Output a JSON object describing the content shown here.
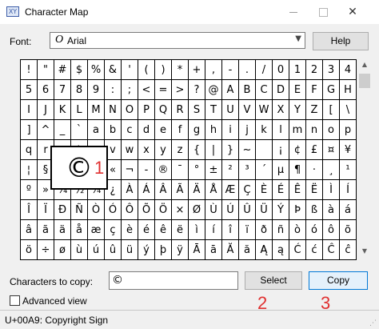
{
  "window": {
    "title": "Character Map",
    "icon": "character-map-app-icon",
    "icon_text": "XY",
    "minimize_icon": "minimize-icon",
    "maximize_icon": "maximize-icon",
    "close_icon": "close-icon",
    "close_glyph": "✕"
  },
  "font": {
    "label": "Font:",
    "selected": "Arial",
    "type_icon": "Ο",
    "dropdown_glyph": "▼"
  },
  "help_label": "Help",
  "grid": {
    "rows": [
      [
        "!",
        "\"",
        "#",
        "$",
        "%",
        "&",
        "'",
        "(",
        ")",
        "*",
        "+",
        ",",
        "-",
        ".",
        "/",
        "0",
        "1",
        "2",
        "3",
        "4"
      ],
      [
        "5",
        "6",
        "7",
        "8",
        "9",
        ":",
        ";",
        "<",
        "=",
        ">",
        "?",
        "@",
        "A",
        "B",
        "C",
        "D",
        "E",
        "F",
        "G",
        "H"
      ],
      [
        "I",
        "J",
        "K",
        "L",
        "M",
        "N",
        "O",
        "P",
        "Q",
        "R",
        "S",
        "T",
        "U",
        "V",
        "W",
        "X",
        "Y",
        "Z",
        "[",
        "\\"
      ],
      [
        "]",
        "^",
        "_",
        "`",
        "a",
        "b",
        "c",
        "d",
        "e",
        "f",
        "g",
        "h",
        "i",
        "j",
        "k",
        "l",
        "m",
        "n",
        "o",
        "p"
      ],
      [
        "q",
        "r",
        "s",
        "t",
        "u",
        "v",
        "w",
        "x",
        "y",
        "z",
        "{",
        "|",
        "}",
        "~",
        " ",
        "¡",
        "¢",
        "£",
        "¤",
        "¥"
      ],
      [
        "¦",
        "§",
        "¨",
        "©",
        "ª",
        "«",
        "¬",
        "-",
        "®",
        "¯",
        "°",
        "±",
        "²",
        "³",
        "´",
        "µ",
        "¶",
        "·",
        "¸",
        "¹"
      ],
      [
        "º",
        "»",
        "¼",
        "½",
        "¾",
        "¿",
        "À",
        "Á",
        "Â",
        "Ã",
        "Ä",
        "Å",
        "Æ",
        "Ç",
        "È",
        "É",
        "Ê",
        "Ë",
        "Ì",
        "Í"
      ],
      [
        "Î",
        "Ï",
        "Ð",
        "Ñ",
        "Ò",
        "Ó",
        "Ô",
        "Õ",
        "Ö",
        "×",
        "Ø",
        "Ù",
        "Ú",
        "Û",
        "Ü",
        "Ý",
        "Þ",
        "ß",
        "à",
        "á"
      ],
      [
        "â",
        "ã",
        "ä",
        "å",
        "æ",
        "ç",
        "è",
        "é",
        "ê",
        "ë",
        "ì",
        "í",
        "î",
        "ï",
        "ð",
        "ñ",
        "ò",
        "ó",
        "ô",
        "õ"
      ],
      [
        "ö",
        "÷",
        "ø",
        "ù",
        "ú",
        "û",
        "ü",
        "ý",
        "þ",
        "ÿ",
        "Ā",
        "ā",
        "Ă",
        "ă",
        "Ą",
        "ą",
        "Ć",
        "ć",
        "Ĉ",
        "ĉ"
      ]
    ],
    "selected_row": 5,
    "selected_col": 3
  },
  "magnified_char": "©",
  "scrollbar": {
    "up_glyph": "▲",
    "down_glyph": "▼"
  },
  "annotations": {
    "one": "1",
    "two": "2",
    "three": "3",
    "color": "#e03030"
  },
  "copy": {
    "label": "Characters to copy:",
    "value": "©",
    "select_label": "Select",
    "copy_label": "Copy"
  },
  "advanced_view_label": "Advanced view",
  "status": "U+00A9: Copyright Sign",
  "grip_glyph": "⋰"
}
